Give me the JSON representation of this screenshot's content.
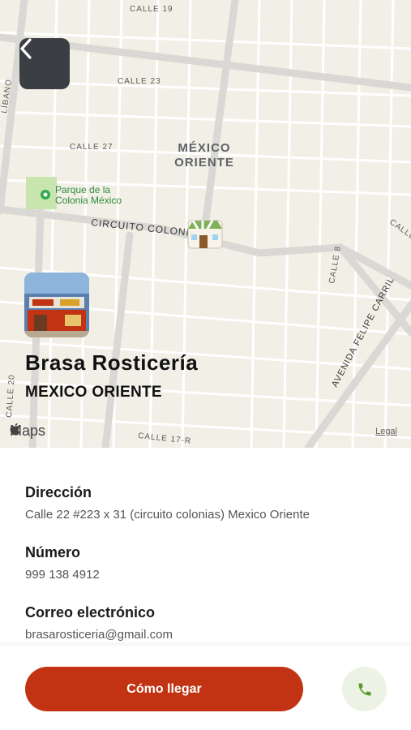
{
  "map": {
    "labels": {
      "calle19": "CALLE 19",
      "calle23": "CALLE 23",
      "calle27": "CALLE 27",
      "libano": "LÍBANO",
      "mexico": "MÉXICO",
      "oriente": "ORIENTE",
      "park1": "Parque de la",
      "park2": "Colonia México",
      "circuito": "CIRCUITO COLONI",
      "calle8": "CALLE 8",
      "felipe": "AVENIDA FELIPE CARRIL",
      "calle20": "CALLE 20",
      "calle17r": "CALLE 17-R",
      "calle_r": "CALLE"
    },
    "attribution": "Maps",
    "legal": "Legal"
  },
  "store": {
    "name": "Brasa Rosticería",
    "area": "MEXICO ORIENTE"
  },
  "info": {
    "address_label": "Dirección",
    "address_value": "Calle 22 #223 x 31 (circuito colonias) Mexico Oriente",
    "phone_label": "Número",
    "phone_value": "999 138 4912",
    "email_label": "Correo electrónico",
    "email_value": "brasarosticeria@gmail.com"
  },
  "actions": {
    "directions_label": "Cómo llegar",
    "call_icon": "phone-icon"
  },
  "colors": {
    "accent": "#c13312",
    "call_bg": "#edf3e4",
    "call_icon": "#5a9a2a",
    "back_bg": "#3b3e42"
  }
}
